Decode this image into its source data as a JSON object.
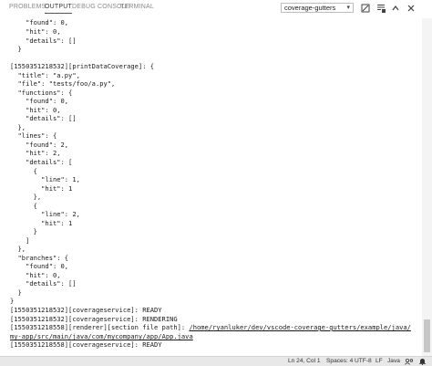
{
  "panel": {
    "tabs": [
      {
        "label": "PROBLEMS"
      },
      {
        "label": "OUTPUT"
      },
      {
        "label": "DEBUG CONSOLE"
      },
      {
        "label": "TERMINAL"
      }
    ],
    "channel_selected": "coverage-gutters",
    "icons": [
      "clear-output-icon",
      "lock-scroll-icon",
      "maximize-panel-icon",
      "close-panel-icon"
    ]
  },
  "output_lines": [
    "    \"found\": 0,",
    "    \"hit\": 0,",
    "    \"details\": []",
    "  }",
    "[1550351218532][printDataCoverage]: {",
    "  \"title\": \"a.py\",",
    "  \"file\": \"tests/foo/a.py\",",
    "  \"functions\": {",
    "    \"found\": 0,",
    "    \"hit\": 0,",
    "    \"details\": []",
    "  },",
    "  \"lines\": {",
    "    \"found\": 2,",
    "    \"hit\": 2,",
    "    \"details\": [",
    "      {",
    "        \"line\": 1,",
    "        \"hit\": 1",
    "      },",
    "      {",
    "        \"line\": 2,",
    "        \"hit\": 1",
    "      }",
    "    ]",
    "  },",
    "  \"branches\": {",
    "    \"found\": 0,",
    "    \"hit\": 0,",
    "    \"details\": []",
    "  }",
    "}",
    "[1550351218532][coverageservice]: READY",
    "[1550351218532][coverageservice]: RENDERING",
    "[1550351218558][renderer][section file path]: ",
    "my-app/src/main/java/com/mycompany/app/App.java",
    "[1550351218558][coverageservice]: READY"
  ],
  "output_link": "/home/ryanluker/dev/vscode-coverage-gutters/example/java/",
  "status_bar": {
    "position": "Ln 24, Col 1",
    "spaces": "Spaces: 4",
    "encoding": "UTF-8",
    "eol": "LF",
    "language": "Java"
  },
  "colors": {
    "background": "#ffffff",
    "text": "#1a1a1a",
    "status_bar": "#e8e8e8",
    "tab_active": "#333333",
    "tab_inactive": "#8a8a8a"
  }
}
